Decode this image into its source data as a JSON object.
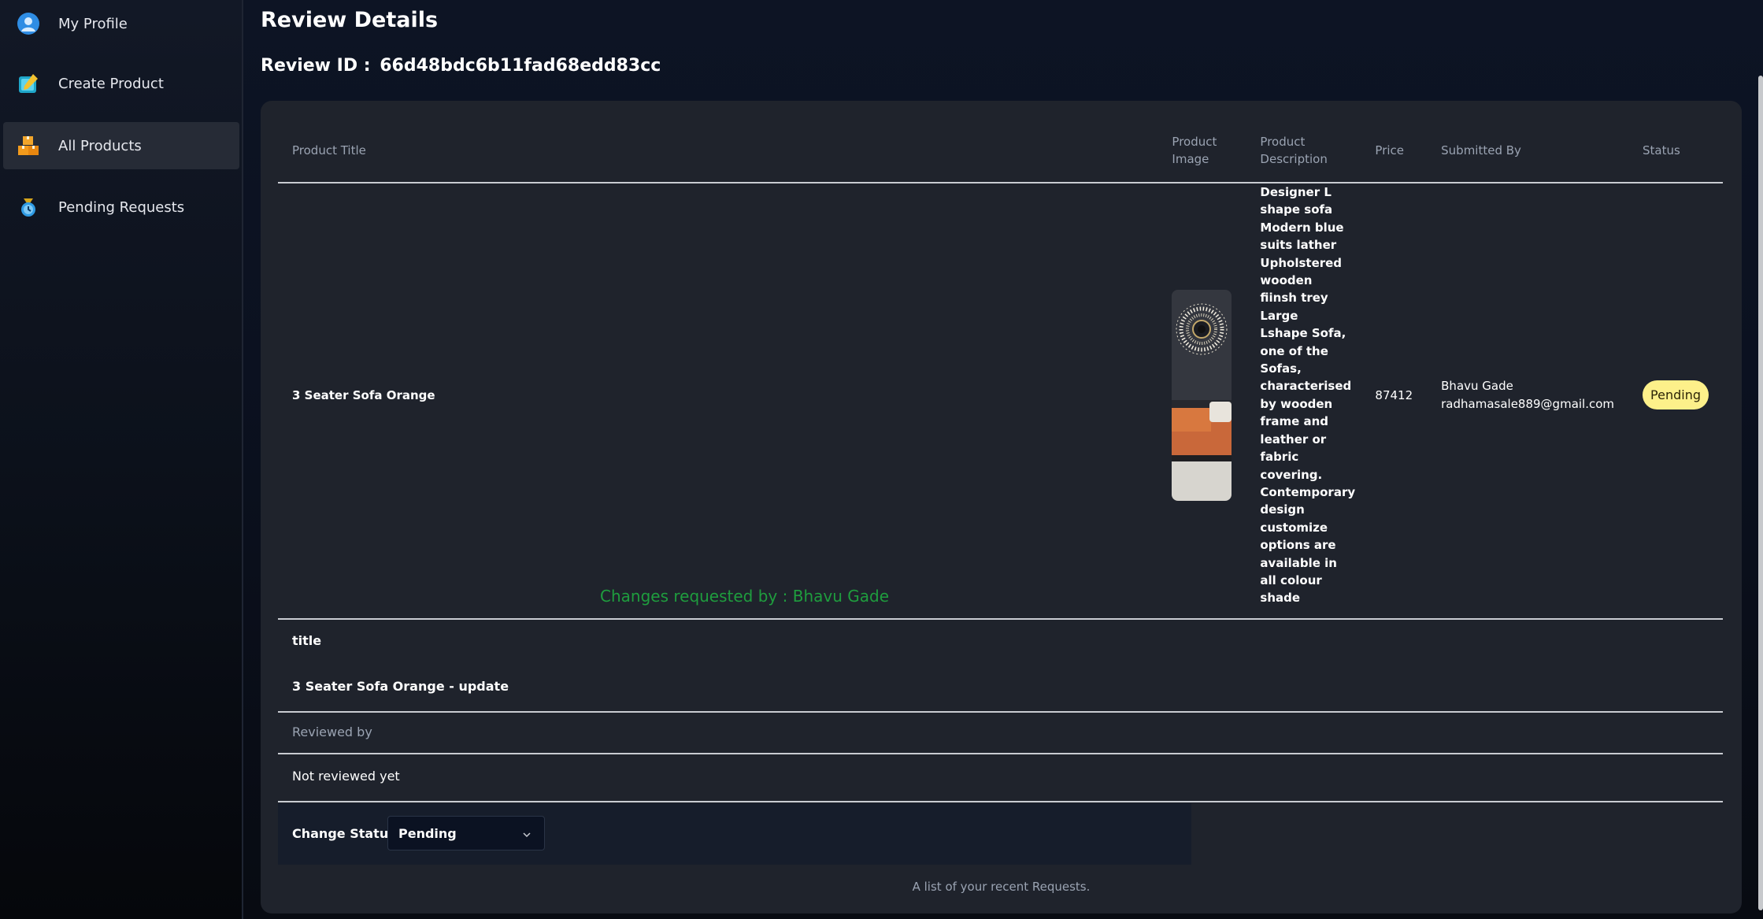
{
  "sidebar": {
    "items": [
      {
        "label": "My Profile",
        "icon": "user-icon"
      },
      {
        "label": "Create Product",
        "icon": "create-product-icon"
      },
      {
        "label": "All Products",
        "icon": "boxes-icon",
        "active": true
      },
      {
        "label": "Pending Requests",
        "icon": "pending-requests-icon"
      }
    ]
  },
  "page": {
    "title": "Review Details",
    "review_id_label": "Review ID :",
    "review_id": "66d48bdc6b11fad68edd83cc"
  },
  "table": {
    "headers": {
      "product_title": "Product Title",
      "product_image": "Product Image",
      "product_description": "Product Description",
      "price": "Price",
      "submitted_by": "Submitted By",
      "status": "Status"
    },
    "row": {
      "product_title": "3 Seater Sofa Orange",
      "product_description": "Designer L shape sofa Modern blue suits lather Upholstered wooden fiinsh trey Large Lshape Sofa, one of the Sofas, characterised by wooden frame and leather or fabric covering. Contemporary design customize options are available in all colour shade",
      "price": "87412",
      "submitter_name": "Bhavu Gade",
      "submitter_email": "radhamasale889@gmail.com",
      "status": "Pending"
    }
  },
  "changes": {
    "requested_by": "Changes requested by : Bhavu Gade",
    "field_name": "title",
    "field_value": "3 Seater Sofa Orange - update"
  },
  "review": {
    "reviewed_by_label": "Reviewed by",
    "reviewed_by_value": "Not reviewed yet"
  },
  "change_status": {
    "label": "Change Status",
    "selected": "Pending"
  },
  "caption": "A list of your recent Requests.",
  "colors": {
    "badge_pending": "#fdf08a",
    "changes_label": "#1f9d3e"
  }
}
